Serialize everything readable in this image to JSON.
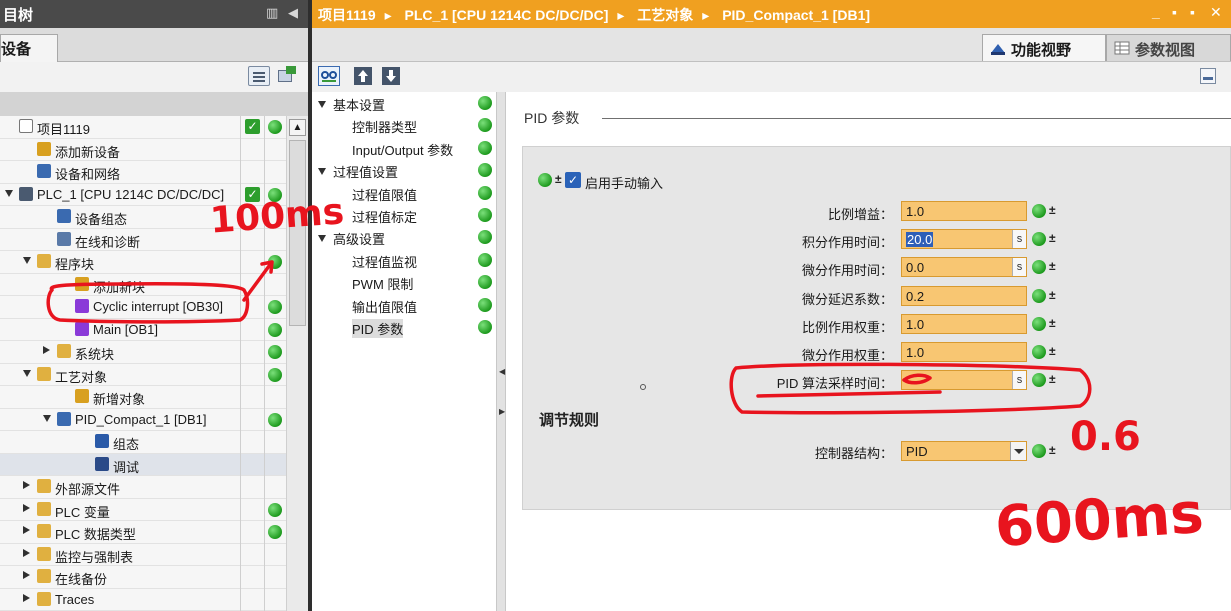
{
  "left_pane": {
    "title": "目树",
    "tab_label": "设备",
    "tree": [
      {
        "label": "项目1119",
        "level": 0,
        "twisty": "",
        "icon": "project-icon",
        "status": "check-dot"
      },
      {
        "label": "添加新设备",
        "level": 1,
        "twisty": "",
        "icon": "add-device-icon",
        "status": ""
      },
      {
        "label": "设备和网络",
        "level": 1,
        "twisty": "",
        "icon": "network-icon",
        "status": ""
      },
      {
        "label": "PLC_1 [CPU 1214C DC/DC/DC]",
        "level": 0,
        "twisty": "open",
        "icon": "plc-icon",
        "status": "check-dot"
      },
      {
        "label": "设备组态",
        "level": 2,
        "twisty": "",
        "icon": "device-config-icon",
        "status": ""
      },
      {
        "label": "在线和诊断",
        "level": 2,
        "twisty": "",
        "icon": "diagnostics-icon",
        "status": ""
      },
      {
        "label": "程序块",
        "level": 1,
        "twisty": "open",
        "icon": "folder-icon",
        "status": "dot"
      },
      {
        "label": "添加新块",
        "level": 3,
        "twisty": "",
        "icon": "add-block-icon",
        "status": ""
      },
      {
        "label": "Cyclic interrupt [OB30]",
        "level": 3,
        "twisty": "",
        "icon": "ob-icon",
        "status": "dot"
      },
      {
        "label": "Main [OB1]",
        "level": 3,
        "twisty": "",
        "icon": "ob-icon",
        "status": "dot"
      },
      {
        "label": "系统块",
        "level": 2,
        "twisty": "closed",
        "icon": "folder-icon",
        "status": "dot"
      },
      {
        "label": "工艺对象",
        "level": 1,
        "twisty": "open",
        "icon": "folder-icon",
        "status": "dot"
      },
      {
        "label": "新增对象",
        "level": 3,
        "twisty": "",
        "icon": "add-object-icon",
        "status": ""
      },
      {
        "label": "PID_Compact_1 [DB1]",
        "level": 2,
        "twisty": "open",
        "icon": "pid-icon",
        "status": "dot"
      },
      {
        "label": "组态",
        "level": 4,
        "twisty": "",
        "icon": "config-icon",
        "status": ""
      },
      {
        "label": "调试",
        "level": 4,
        "twisty": "",
        "icon": "commissioning-icon",
        "status": "",
        "selected": true
      },
      {
        "label": "外部源文件",
        "level": 1,
        "twisty": "closed",
        "icon": "folder-icon",
        "status": ""
      },
      {
        "label": "PLC 变量",
        "level": 1,
        "twisty": "closed",
        "icon": "folder-icon",
        "status": "dot"
      },
      {
        "label": "PLC 数据类型",
        "level": 1,
        "twisty": "closed",
        "icon": "folder-icon",
        "status": "dot"
      },
      {
        "label": "监控与强制表",
        "level": 1,
        "twisty": "closed",
        "icon": "folder-icon",
        "status": ""
      },
      {
        "label": "在线备份",
        "level": 1,
        "twisty": "closed",
        "icon": "folder-icon",
        "status": ""
      },
      {
        "label": "Traces",
        "level": 1,
        "twisty": "closed",
        "icon": "folder-icon",
        "status": ""
      }
    ]
  },
  "editor": {
    "breadcrumb": [
      "项目1119",
      "PLC_1 [CPU 1214C DC/DC/DC]",
      "工艺对象",
      "PID_Compact_1 [DB1]"
    ],
    "window_controls": [
      "_",
      "▪",
      "▪",
      "✕"
    ],
    "view_tabs": [
      {
        "label": "功能视野",
        "icon": "function-view-icon",
        "active": true
      },
      {
        "label": "参数视图",
        "icon": "parameter-view-icon",
        "active": false
      }
    ],
    "nav": [
      {
        "label": "基本设置",
        "indent": 0,
        "twisty": "open"
      },
      {
        "label": "控制器类型",
        "indent": 1,
        "twisty": ""
      },
      {
        "label": "Input/Output 参数",
        "indent": 1,
        "twisty": ""
      },
      {
        "label": "过程值设置",
        "indent": 0,
        "twisty": "open"
      },
      {
        "label": "过程值限值",
        "indent": 1,
        "twisty": ""
      },
      {
        "label": "过程值标定",
        "indent": 1,
        "twisty": ""
      },
      {
        "label": "高级设置",
        "indent": 0,
        "twisty": "open"
      },
      {
        "label": "过程值监视",
        "indent": 1,
        "twisty": ""
      },
      {
        "label": "PWM 限制",
        "indent": 1,
        "twisty": ""
      },
      {
        "label": "输出值限值",
        "indent": 1,
        "twisty": ""
      },
      {
        "label": "PID 参数",
        "indent": 1,
        "twisty": "",
        "selected": true
      }
    ],
    "section_title": "PID 参数",
    "manual_entry_label": "启用手动输入",
    "manual_entry_checked": true,
    "fields": [
      {
        "label": "比例增益：",
        "value": "1.0",
        "unit": ""
      },
      {
        "label": "积分作用时间：",
        "value": "20.0",
        "unit": "s",
        "highlight": true
      },
      {
        "label": "微分作用时间：",
        "value": "0.0",
        "unit": "s"
      },
      {
        "label": "微分延迟系数：",
        "value": "0.2",
        "unit": ""
      },
      {
        "label": "比例作用权重：",
        "value": "1.0",
        "unit": ""
      },
      {
        "label": "微分作用权重：",
        "value": "1.0",
        "unit": ""
      },
      {
        "label": "PID 算法采样时间：",
        "value": "",
        "unit": "s"
      }
    ],
    "control_rule_heading": "调节规则",
    "controller_structure_label": "控制器结构：",
    "controller_structure_value": "PID"
  },
  "annotations": {
    "note_top": "100ms",
    "note_value": "0.6",
    "note_bottom": "600ms",
    "ink_color": "#e8141e"
  },
  "colors": {
    "title_orange": "#f0a020",
    "field_orange": "#f8c672",
    "status_green": "#1e9a1e"
  }
}
